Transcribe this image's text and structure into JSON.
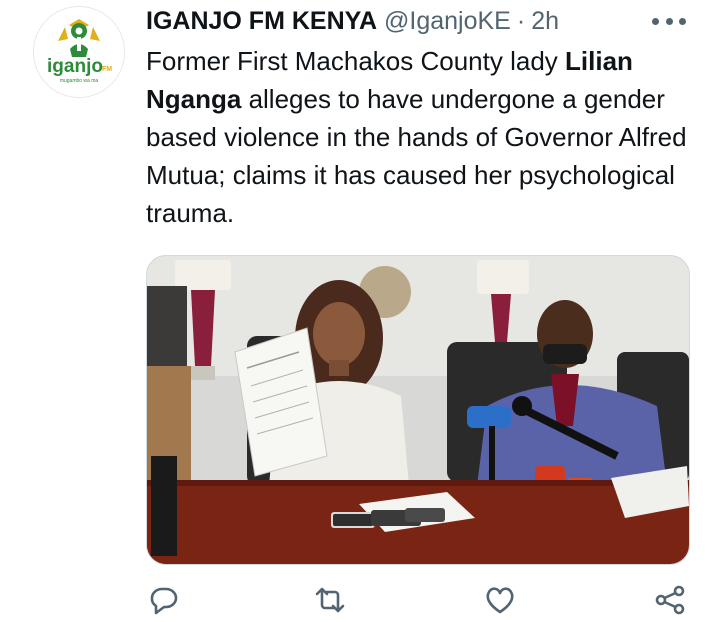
{
  "account": {
    "display_name": "IGANJO FM KENYA",
    "handle": "@IganjoKE",
    "separator": "·",
    "time": "2h",
    "logo_text": "iganjo",
    "logo_fm": "FM",
    "logo_tagline": "mugambo wa ma"
  },
  "tweet": {
    "text_part1": "Former First Machakos County lady ",
    "text_bold": "Lilian Nganga",
    "text_part2": " alleges to have undergone a gender based violence in the hands of Governor Alfred Mutua; claims it has caused her psychological trauma."
  },
  "icons": {
    "more": "more-horizontal-icon",
    "reply": "reply-icon",
    "retweet": "retweet-icon",
    "like": "like-icon",
    "share": "share-icon"
  },
  "colors": {
    "text": "#0f1419",
    "muted": "#536471",
    "logo_green": "#2e8b3a",
    "logo_gold": "#e0b01a",
    "border": "#cfd9de"
  }
}
